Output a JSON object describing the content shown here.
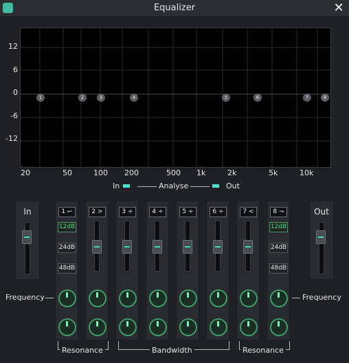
{
  "window": {
    "title": "Equalizer",
    "app_icon": "equalizer-app-icon",
    "close_icon": "close-x-icon"
  },
  "graph": {
    "y_ticks": [
      "12",
      "6",
      "0",
      "-6",
      "-12"
    ],
    "x_ticks": [
      "20",
      "50",
      "100",
      "200",
      "500",
      "1k",
      "2k",
      "5k",
      "10k"
    ],
    "nodes": [
      "1",
      "2",
      "3",
      "4",
      "5",
      "6",
      "7",
      "8"
    ]
  },
  "analyse": {
    "in": "In",
    "label": "Analyse",
    "out": "Out",
    "accent": "#4ee0d0"
  },
  "panels": {
    "in": "In",
    "out": "Out"
  },
  "bands": [
    {
      "label": "1",
      "glyph": "↽"
    },
    {
      "label": "2",
      "glyph": ">"
    },
    {
      "label": "3",
      "glyph": "÷"
    },
    {
      "label": "4",
      "glyph": "÷"
    },
    {
      "label": "5",
      "glyph": "÷"
    },
    {
      "label": "6",
      "glyph": "÷"
    },
    {
      "label": "7",
      "glyph": "<"
    },
    {
      "label": "8",
      "glyph": "⇁"
    }
  ],
  "slopes_left": [
    "12dB",
    "24dB",
    "48dB"
  ],
  "slopes_right": [
    "12dB",
    "24dB",
    "48dB"
  ],
  "frequency_label": "Frequency",
  "groups": {
    "resonance": "Resonance",
    "bandwidth": "Bandwidth"
  }
}
